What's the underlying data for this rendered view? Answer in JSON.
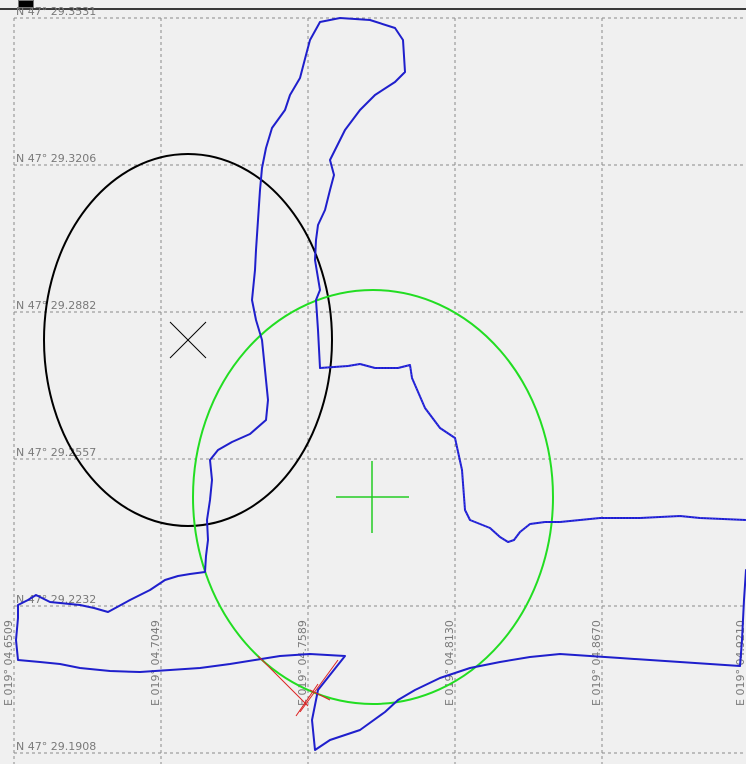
{
  "latitude_labels": [
    "N 47° 29.3531",
    "N 47° 29.3206",
    "N 47° 29.2882",
    "N 47° 29.2557",
    "N 47° 29.2232",
    "N 47° 29.1908"
  ],
  "longitude_labels": [
    "E 019° 04.6509",
    "E 019° 04.7049",
    "E 019° 04.7589",
    "E 019° 04.8130",
    "E 019° 04.8670",
    "E 019° 04.9210"
  ],
  "colors": {
    "background": "#f0f0f0",
    "grid": "#8a8a8a",
    "track": "#1f1fcc",
    "estimate_ellipse_black": "#000000",
    "estimate_ellipse_green": "#22dd22",
    "error_segments": "#dd2222"
  },
  "markers": {
    "black_center_icon": "x-cross-icon",
    "green_center_icon": "plus-cross-icon"
  }
}
